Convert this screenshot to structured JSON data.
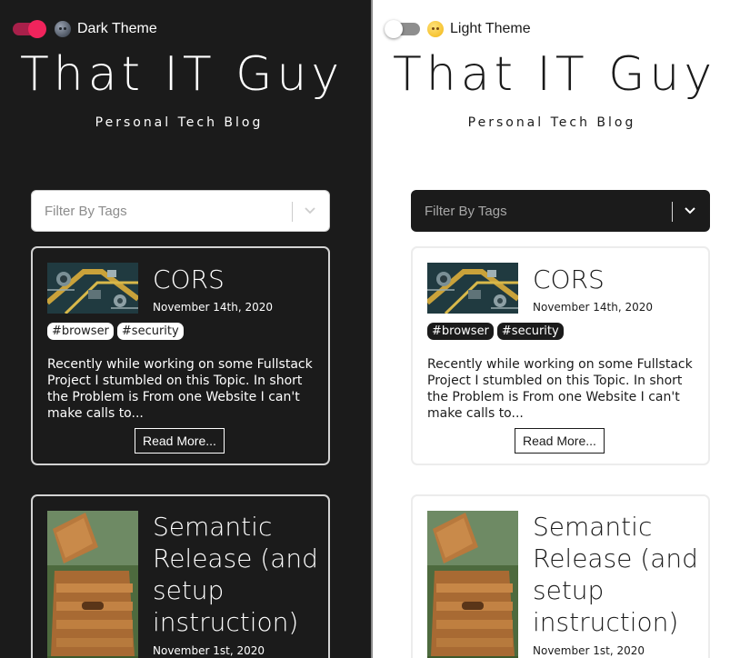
{
  "dark": {
    "theme_label": "Dark Theme",
    "theme_icon": "moon-emoji-icon",
    "toggle_on": true,
    "site_title": "That IT Guy",
    "site_subtitle": "Personal Tech Blog",
    "filter_placeholder": "Filter By Tags",
    "posts": [
      {
        "title": "CORS",
        "date": "November 14th, 2020",
        "tags": [
          "#browser",
          "#security"
        ],
        "excerpt": "Recently while working on some Fullstack Project I stumbled on this Topic. In short the Problem is From one Website I can't make calls to...",
        "read_more": "Read More..."
      },
      {
        "title": "Semantic Release (and setup instruction)",
        "date": "November 1st, 2020"
      }
    ]
  },
  "light": {
    "theme_label": "Light Theme",
    "theme_icon": "sun-emoji-icon",
    "toggle_on": false,
    "site_title": "That IT Guy",
    "site_subtitle": "Personal Tech Blog",
    "filter_placeholder": "Filter By Tags",
    "posts": [
      {
        "title": "CORS",
        "date": "November 14th, 2020",
        "tags": [
          "#browser",
          "#security"
        ],
        "excerpt": "Recently while working on some Fullstack Project I stumbled on this Topic. In short the Problem is From one Website I can't make calls to...",
        "read_more": "Read More..."
      },
      {
        "title": "Semantic Release (and setup instruction)",
        "date": "November 1st, 2020"
      }
    ]
  },
  "colors": {
    "dark_bg": "#1b1b1b",
    "light_bg": "#ffffff",
    "toggle_accent": "#f0245c"
  }
}
